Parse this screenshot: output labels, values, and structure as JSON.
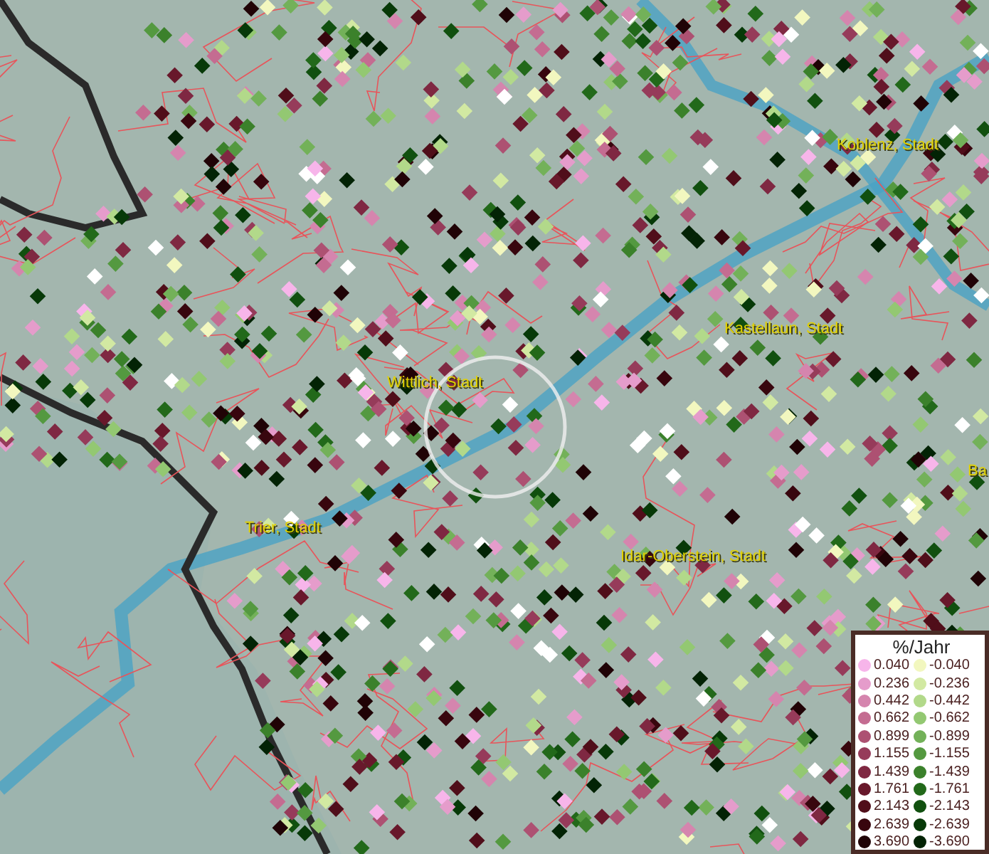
{
  "map": {
    "places": [
      {
        "label": "Koblenz, Stadt"
      },
      {
        "label": "Kastellaun, Stadt"
      },
      {
        "label": "Wittlich, Stadt"
      },
      {
        "label": "Ba"
      },
      {
        "label": "Trier, Stadt"
      },
      {
        "label": "Idar-Oberstein, Stadt"
      }
    ]
  },
  "legend": {
    "title": "%/Jahr",
    "columns": [
      [
        {
          "label": "0.040",
          "color": "#f7b5ea"
        },
        {
          "label": "0.236",
          "color": "#e59ccb"
        },
        {
          "label": "0.442",
          "color": "#d585ae"
        },
        {
          "label": "0.662",
          "color": "#c46c91"
        },
        {
          "label": "0.899",
          "color": "#ad5172"
        },
        {
          "label": "1.155",
          "color": "#963b5a"
        },
        {
          "label": "1.439",
          "color": "#7f2842"
        },
        {
          "label": "1.761",
          "color": "#68182b"
        },
        {
          "label": "2.143",
          "color": "#500e1a"
        },
        {
          "label": "2.639",
          "color": "#38060e"
        },
        {
          "label": "3.690",
          "color": "#200306"
        }
      ],
      [
        {
          "label": "-0.040",
          "color": "#f2f7bf"
        },
        {
          "label": "-0.236",
          "color": "#d2e9a2"
        },
        {
          "label": "-0.442",
          "color": "#b2d98a"
        },
        {
          "label": "-0.662",
          "color": "#93c872"
        },
        {
          "label": "-0.899",
          "color": "#73b159"
        },
        {
          "label": "-1.155",
          "color": "#549940"
        },
        {
          "label": "-1.439",
          "color": "#3b812b"
        },
        {
          "label": "-1.761",
          "color": "#22691a"
        },
        {
          "label": "-2.143",
          "color": "#11500f"
        },
        {
          "label": "-2.639",
          "color": "#073908"
        },
        {
          "label": "-3.690",
          "color": "#032305"
        }
      ]
    ]
  }
}
